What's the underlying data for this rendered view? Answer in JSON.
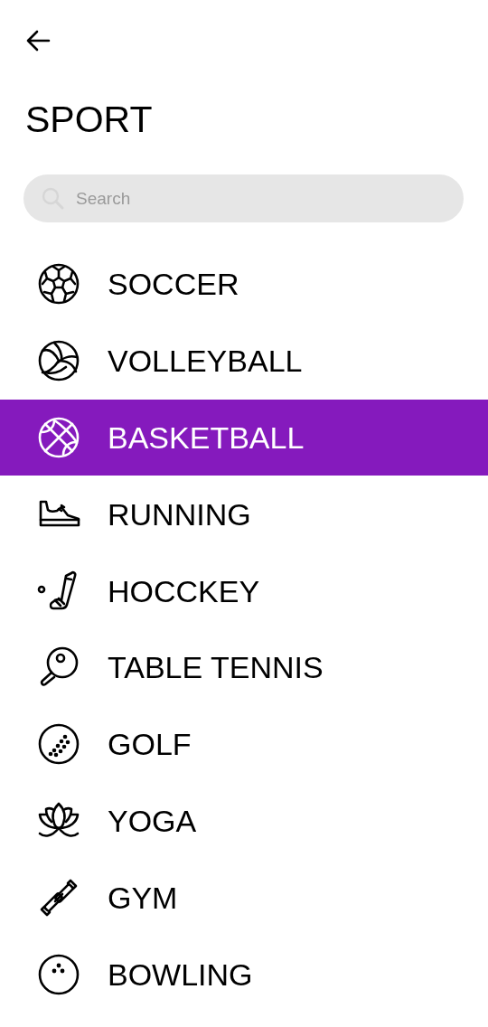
{
  "title": "SPORT",
  "search": {
    "placeholder": "Search"
  },
  "items": [
    {
      "label": "SOCCER",
      "selected": false
    },
    {
      "label": "VOLLEYBALL",
      "selected": false
    },
    {
      "label": "BASKETBALL",
      "selected": true
    },
    {
      "label": "RUNNING",
      "selected": false
    },
    {
      "label": "HOCCKEY",
      "selected": false
    },
    {
      "label": "TABLE TENNIS",
      "selected": false
    },
    {
      "label": "GOLF",
      "selected": false
    },
    {
      "label": "YOGA",
      "selected": false
    },
    {
      "label": "GYM",
      "selected": false
    },
    {
      "label": "BOWLING",
      "selected": false
    }
  ]
}
